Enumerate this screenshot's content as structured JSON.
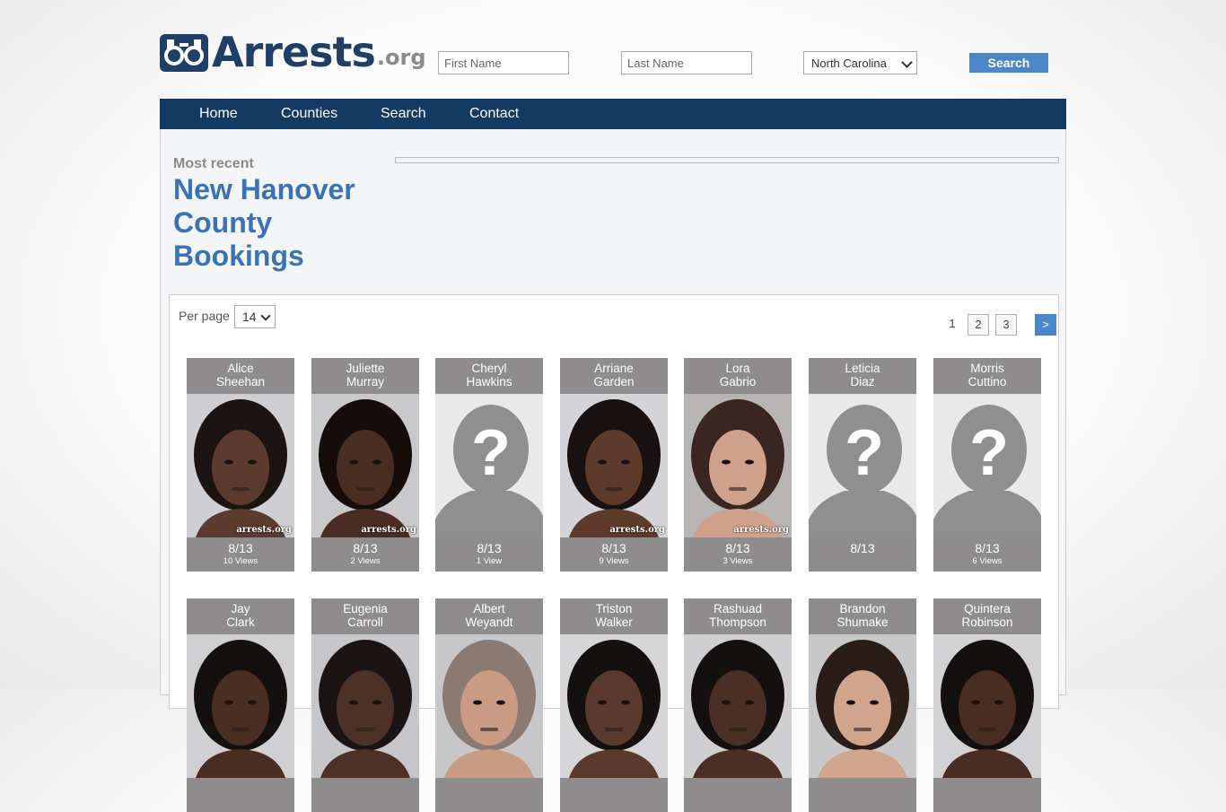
{
  "header": {
    "logo_main": "Arrests",
    "logo_tld": ".org",
    "first_name_placeholder": "First Name",
    "last_name_placeholder": "Last Name",
    "state_selected": "North Carolina",
    "search_label": "Search"
  },
  "nav": {
    "items": [
      {
        "label": "Home"
      },
      {
        "label": "Counties"
      },
      {
        "label": "Search"
      },
      {
        "label": "Contact"
      }
    ]
  },
  "main": {
    "most_recent": "Most recent",
    "title": "New Hanover County Bookings",
    "per_page_label": "Per page",
    "per_page_value": "14",
    "pagination": {
      "current": "1",
      "page2": "2",
      "page3": "3",
      "next": ">"
    }
  },
  "bookings": [
    {
      "first": "Alice",
      "last": "Sheehan",
      "date": "8/13",
      "views": "10 Views",
      "photo": "mugshot",
      "skin": "#5a3b2e",
      "hair": "#1b1412",
      "bg": "#cfcfd3",
      "watermark": "arrests.org"
    },
    {
      "first": "Juliette",
      "last": "Murray",
      "date": "8/13",
      "views": "2 Views",
      "photo": "mugshot",
      "skin": "#4a2d22",
      "hair": "#140d0c",
      "bg": "#c9c9cc",
      "watermark": "arrests.org"
    },
    {
      "first": "Cheryl",
      "last": "Hawkins",
      "date": "8/13",
      "views": "1 View",
      "photo": "placeholder"
    },
    {
      "first": "Arriane",
      "last": "Garden",
      "date": "8/13",
      "views": "9 Views",
      "photo": "mugshot",
      "skin": "#5d3b2b",
      "hair": "#171112",
      "bg": "#d4d4d8",
      "watermark": "arrests.org"
    },
    {
      "first": "Lora",
      "last": "Gabrio",
      "date": "8/13",
      "views": "3 Views",
      "photo": "mugshot",
      "skin": "#cfa08c",
      "hair": "#3a2520",
      "bg": "#b8b6b5",
      "watermark": "arrests.org"
    },
    {
      "first": "Leticia",
      "last": "Diaz",
      "date": "8/13",
      "views": "",
      "photo": "placeholder"
    },
    {
      "first": "Morris",
      "last": "Cuttino",
      "date": "8/13",
      "views": "6 Views",
      "photo": "placeholder"
    },
    {
      "first": "Jay",
      "last": "Clark",
      "date": "",
      "views": "",
      "photo": "mugshot",
      "skin": "#4b2e22",
      "hair": "#141010",
      "bg": "#d0d0d3"
    },
    {
      "first": "Eugenia",
      "last": "Carroll",
      "date": "",
      "views": "",
      "photo": "mugshot",
      "skin": "#4e3126",
      "hair": "#1a1414",
      "bg": "#c6c6ca"
    },
    {
      "first": "Albert",
      "last": "Weyandt",
      "date": "",
      "views": "",
      "photo": "mugshot",
      "skin": "#c99a84",
      "hair": "#8a7a72",
      "bg": "#c7c7c9"
    },
    {
      "first": "Triston",
      "last": "Walker",
      "date": "",
      "views": "",
      "photo": "mugshot",
      "skin": "#5a3a2d",
      "hair": "#141010",
      "bg": "#d6d6d9"
    },
    {
      "first": "Rashuad",
      "last": "Thompson",
      "date": "",
      "views": "",
      "photo": "mugshot",
      "skin": "#4c2f24",
      "hair": "#141010",
      "bg": "#cfcfd2"
    },
    {
      "first": "Brandon",
      "last": "Shumake",
      "date": "",
      "views": "",
      "photo": "mugshot",
      "skin": "#d1a48e",
      "hair": "#2a1d18",
      "bg": "#c8c8ca"
    },
    {
      "first": "Quintera",
      "last": "Robinson",
      "date": "",
      "views": "",
      "photo": "mugshot",
      "skin": "#4a2d22",
      "hair": "#141010",
      "bg": "#d2d2d5"
    }
  ]
}
